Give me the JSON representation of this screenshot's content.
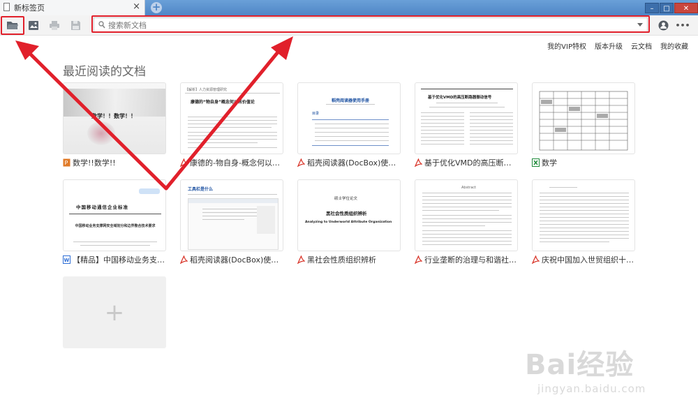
{
  "tab": {
    "title": "新标签页",
    "close": "×",
    "new_tab": "+"
  },
  "window": {
    "minimize": "–",
    "maximize": "□",
    "close": "✕"
  },
  "toolbar": {
    "open_icon": "folder-open-icon",
    "image_icon": "image-icon",
    "print_icon": "printer-icon",
    "save_icon": "floppy-disk-icon",
    "search_placeholder": "搜索新文档",
    "account_icon": "user-icon",
    "more_label": "•••"
  },
  "top_links": [
    "我的VIP特权",
    "版本升级",
    "云文档",
    "我的收藏"
  ],
  "section_title": "最近阅读的文档",
  "documents": [
    {
      "caption": "数学!!数学!!",
      "type": "ppt"
    },
    {
      "caption": "康德的-物自身-概念何以有价...",
      "type": "pdf"
    },
    {
      "caption": "稻壳阅读器(DocBox)使用手...",
      "type": "pdf"
    },
    {
      "caption": "基于优化VMD的高压断路器...",
      "type": "pdf"
    },
    {
      "caption": "数学",
      "type": "xls"
    },
    {
      "caption": "【精品】中国移动业务支撑网...",
      "type": "doc"
    },
    {
      "caption": "稻壳阅读器(DocBox)使用手...",
      "type": "pdf"
    },
    {
      "caption": "黑社会性质组织辨析",
      "type": "pdf"
    },
    {
      "caption": "行业垄断的治理与和谐社会的...",
      "type": "pdf"
    },
    {
      "caption": "庆祝中国加入世贸组织十周年...",
      "type": "pdf"
    }
  ],
  "thumbs": {
    "t0": {
      "title": "数学！！数学！！"
    },
    "t1": {
      "title": "康德的“物自身”概念何以有价值论",
      "head": "【解析】人力资源管理研究"
    },
    "t2": {
      "title": "稻壳阅读器使用手册",
      "sub": "目录"
    },
    "t3": {
      "title": "基于优化VMD的高压断路器振动信号"
    },
    "t5": {
      "title": "中国移动通信企业标准",
      "sub": "中国移动业务支撑网安全域划分和边界整合技术要求"
    },
    "t6": {
      "title": "工具栏是什么"
    },
    "t7": {
      "title": "黑社会性质组织辨析",
      "en": "Analyzing to Underworld Attribute Organization",
      "head": "硕士学位论文"
    },
    "t8": {
      "head": "Abstract"
    }
  },
  "add_label": "+",
  "watermark": {
    "brand": "Bai经验",
    "url": "jingyan.baidu.com"
  },
  "colors": {
    "annotation": "#e1202b",
    "pdf": "#d9382c",
    "ppt": "#e07a27",
    "xls": "#1e8a3a",
    "doc": "#2f6fd6"
  }
}
